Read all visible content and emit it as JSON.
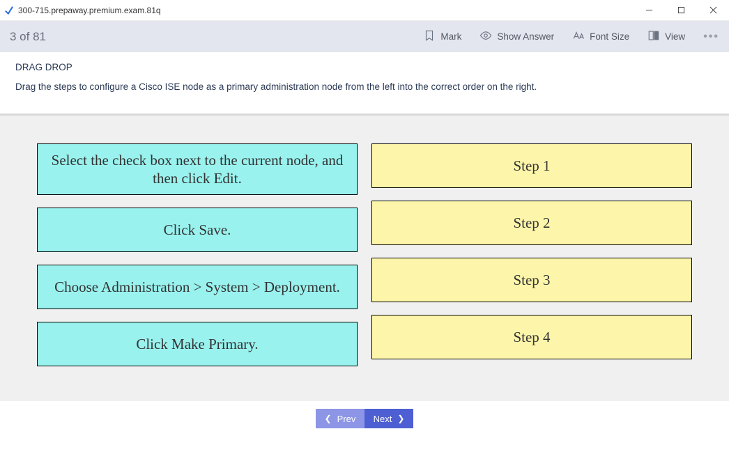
{
  "window": {
    "title": "300-715.prepaway.premium.exam.81q"
  },
  "toolbar": {
    "counter": "3 of 81",
    "mark": "Mark",
    "show_answer": "Show Answer",
    "font_size": "Font Size",
    "view": "View"
  },
  "question": {
    "type_label": "DRAG DROP",
    "prompt": "Drag the steps to configure a Cisco ISE node as a primary administration node from the left into the correct order on the right."
  },
  "drag": {
    "sources": [
      "Select the check box next to the current node, and then click Edit.",
      "Click Save.",
      "Choose Administration > System > Deployment.",
      "Click Make Primary."
    ],
    "targets": [
      "Step 1",
      "Step 2",
      "Step 3",
      "Step 4"
    ]
  },
  "nav": {
    "prev": "Prev",
    "next": "Next"
  }
}
